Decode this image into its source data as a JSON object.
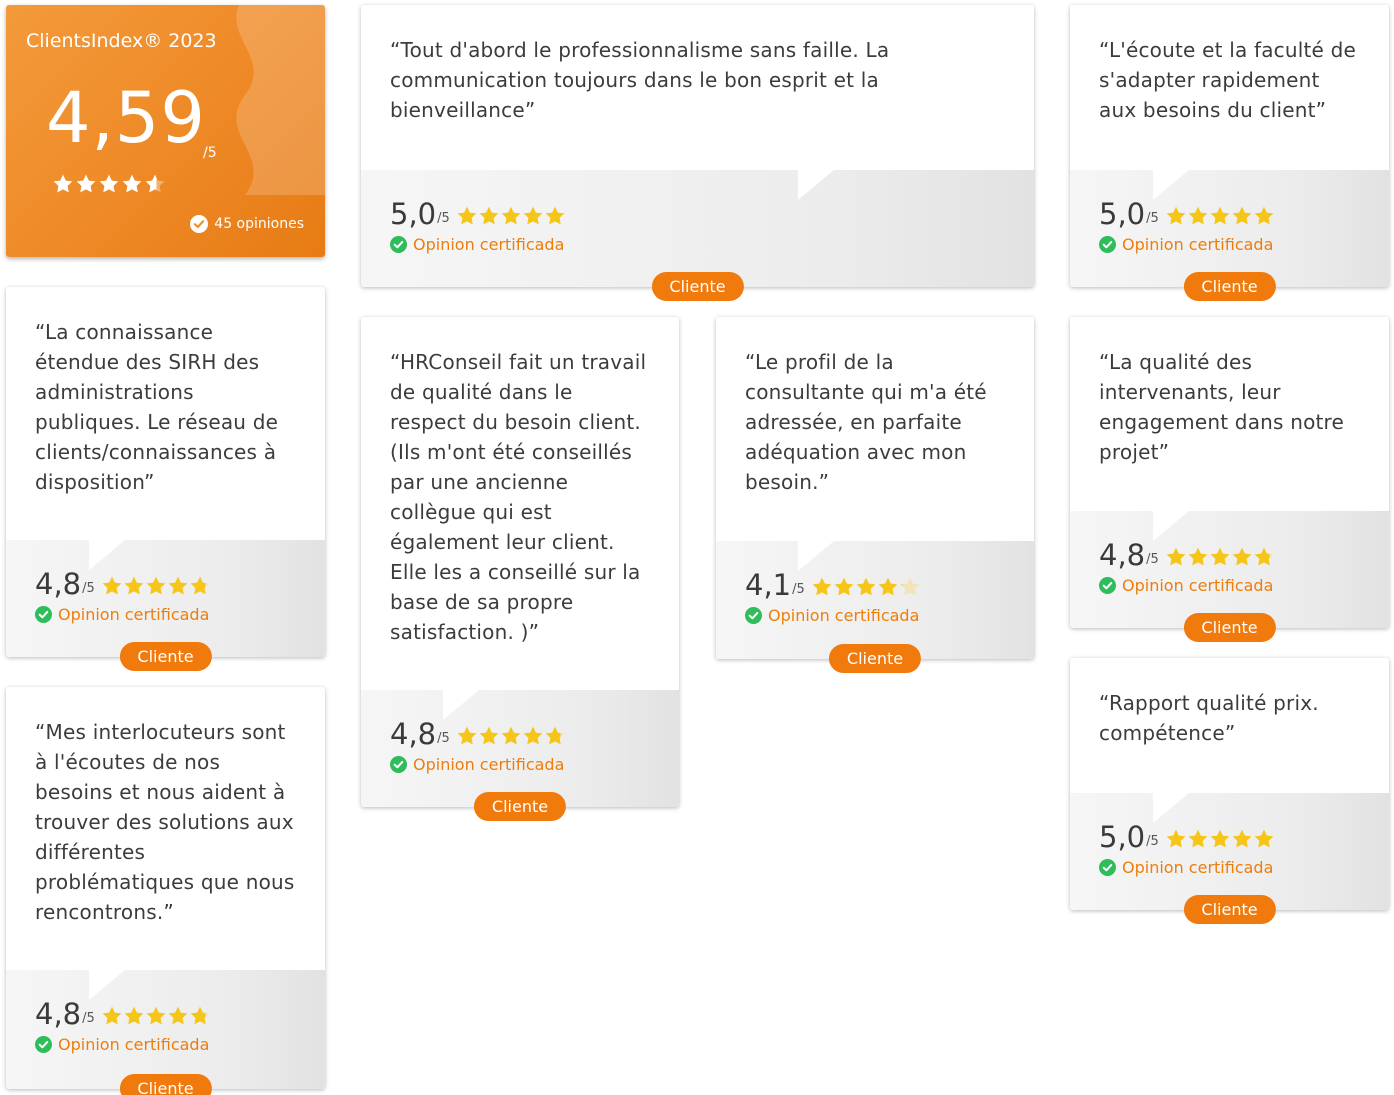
{
  "summary": {
    "brand": "ClientsIndex® 2023",
    "score": "4,59",
    "out_of": "/5",
    "stars": 4.59,
    "count_label": "45 opiniones"
  },
  "common": {
    "per_label": "/5",
    "cert_label": "Opinion certificada",
    "badge_label": "Cliente"
  },
  "reviews": [
    {
      "quote": "“Tout d'abord le professionnalisme sans faille. La communication toujours dans le bon esprit et la bienveillance”",
      "score": "5,0",
      "stars": 5.0
    },
    {
      "quote": "“L'écoute et la faculté de s'adapter rapidement aux besoins du client”",
      "score": "5,0",
      "stars": 5.0
    },
    {
      "quote": "“La connaissance étendue des SIRH des administrations publiques. Le réseau de clients/connaissances à disposition”",
      "score": "4,8",
      "stars": 4.8
    },
    {
      "quote": "“HRConseil fait un travail de qualité dans le respect du besoin client. (Ils m'ont été conseillés par une ancienne collègue qui est également leur client. Elle les a conseillé sur la base de sa propre satisfaction. )”",
      "score": "4,8",
      "stars": 4.8
    },
    {
      "quote": "“Le profil de la consultante qui m'a été adressée, en parfaite adéquation avec mon besoin.”",
      "score": "4,1",
      "stars": 4.1
    },
    {
      "quote": "“La qualité des intervenants, leur engagement dans notre projet”",
      "score": "4,8",
      "stars": 4.8
    },
    {
      "quote": "“Mes interlocuteurs sont à l'écoutes de nos besoins et nous aident à trouver des solutions aux différentes problématiques que nous rencontrons.”",
      "score": "4,8",
      "stars": 4.8
    },
    {
      "quote": "“Rapport qualité prix. compétence”",
      "score": "5,0",
      "stars": 5.0
    }
  ],
  "colors": {
    "accent": "#f07a0c",
    "star": "#f5c518",
    "check": "#2ebd5a"
  }
}
